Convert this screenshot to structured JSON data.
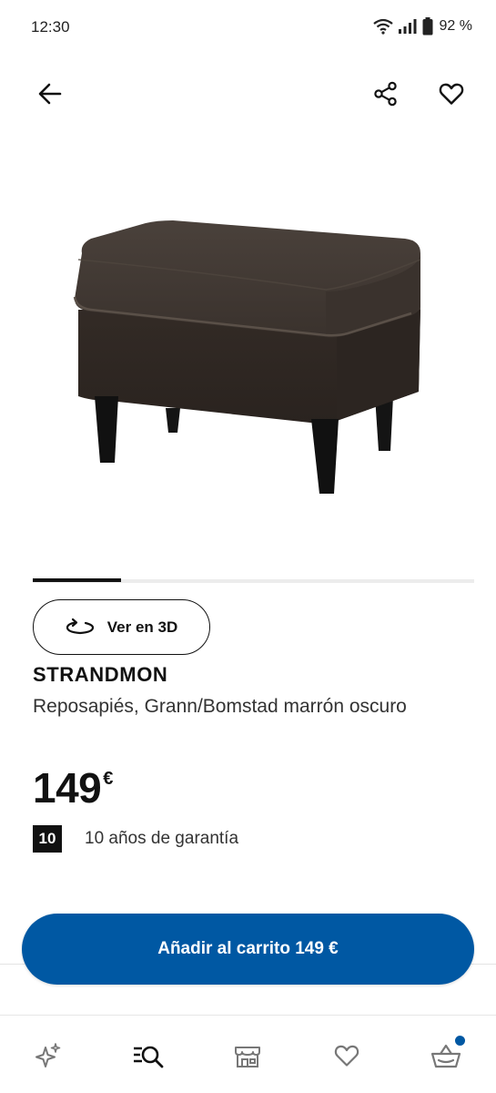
{
  "status_bar": {
    "time": "12:30",
    "battery": "92 %",
    "icons": [
      "wifi-icon",
      "signal-icon",
      "battery-icon"
    ]
  },
  "top_bar": {
    "icons": [
      "back-arrow-icon",
      "share-icon",
      "heart-icon"
    ]
  },
  "gallery": {
    "image_alt": "STRANDMON reposapiés marrón oscuro",
    "active_index": 1
  },
  "actions": {
    "view_3d_label": "Ver en 3D"
  },
  "product": {
    "name": "STRANDMON",
    "description": "Reposapiés, Grann/Bomstad marrón oscuro",
    "price": "149",
    "currency": "€"
  },
  "warranty": {
    "years": "10",
    "text": "10 años de garantía"
  },
  "cart": {
    "add_label": "Añadir al carrito 149 €"
  },
  "bottom_nav": {
    "items": [
      "sparkle-icon",
      "search-list-icon",
      "store-icon",
      "heart-icon",
      "basket-icon"
    ],
    "basket_has_badge": true
  },
  "colors": {
    "primary": "#0058a3",
    "text": "#111111",
    "secondary_text": "#333333"
  }
}
